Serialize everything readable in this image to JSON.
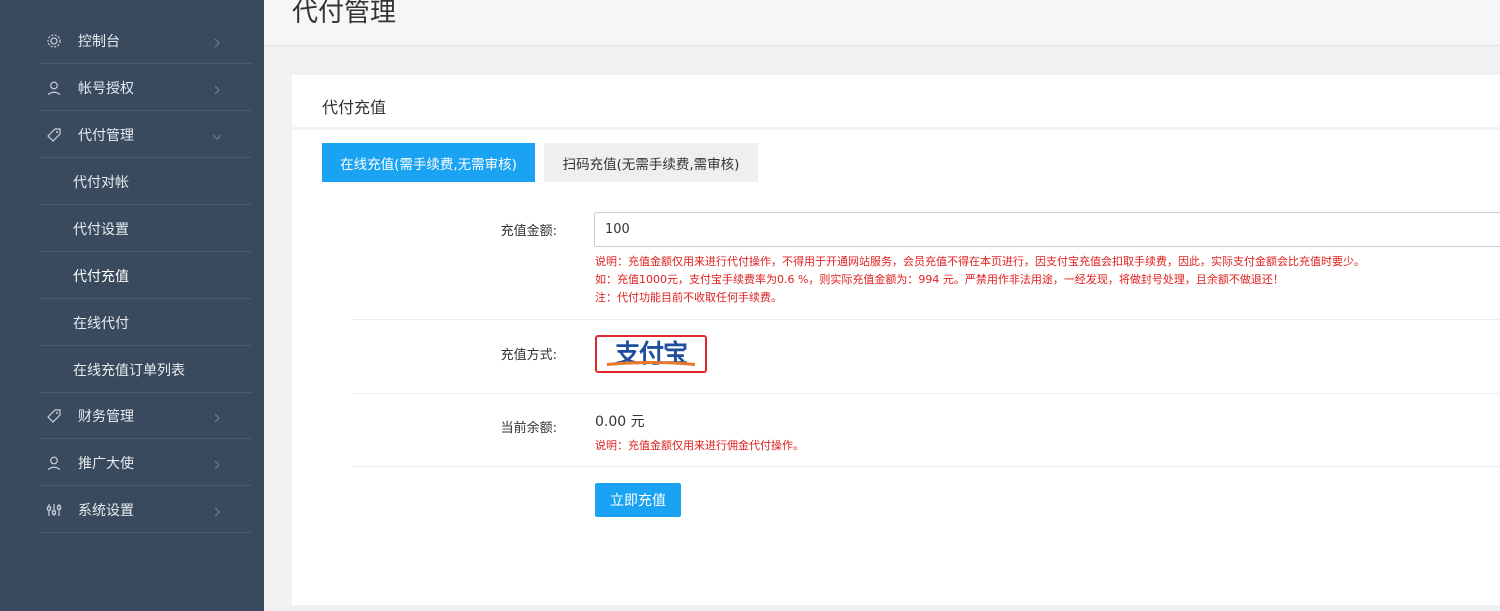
{
  "sidebar": {
    "items": [
      {
        "label": "控制台",
        "icon": "gear-icon"
      },
      {
        "label": "帐号授权",
        "icon": "user-icon"
      },
      {
        "label": "代付管理",
        "icon": "tag-icon"
      },
      {
        "label": "财务管理",
        "icon": "tag-icon"
      },
      {
        "label": "推广大使",
        "icon": "user-icon"
      },
      {
        "label": "系统设置",
        "icon": "sliders-icon"
      }
    ],
    "subitems": [
      {
        "label": "代付对帐"
      },
      {
        "label": "代付设置"
      },
      {
        "label": "代付充值"
      },
      {
        "label": "在线代付"
      },
      {
        "label": "在线充值订单列表"
      }
    ]
  },
  "header": {
    "title": "代付管理"
  },
  "card": {
    "title": "代付充值",
    "tabs": [
      {
        "label": "在线充值(需手续费,无需审核)",
        "active": true
      },
      {
        "label": "扫码充值(无需手续费,需审核)",
        "active": false
      }
    ],
    "amount": {
      "label": "充值金额:",
      "value": "100",
      "notes": [
        "说明：充值金额仅用来进行代付操作，不得用于开通网站服务，会员充值不得在本页进行，因支付宝充值会扣取手续费，因此，实际支付金额会比充值时要少。",
        "如：充值1000元，支付宝手续费率为0.6 %，则实际充值金额为：994 元。严禁用作非法用途，一经发现，将做封号处理，且余额不做退还！",
        "注：代付功能目前不收取任何手续费。"
      ]
    },
    "method": {
      "label": "充值方式:",
      "logo_text": "支付宝"
    },
    "balance": {
      "label": "当前余额:",
      "value": "0.00 元",
      "note": "说明：充值金额仅用来进行佣金代付操作。"
    },
    "submit_label": "立即充值"
  },
  "colors": {
    "sidebar_bg": "#3a4a5e",
    "accent": "#1aa3f3",
    "warning": "#e02020"
  }
}
